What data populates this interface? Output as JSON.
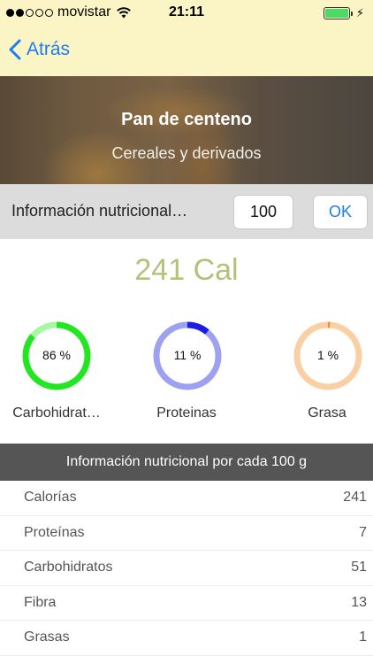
{
  "status_bar": {
    "carrier": "movistar",
    "signal_bars_filled": 2,
    "signal_bars_total": 5,
    "time": "21:11",
    "battery_level": 1.0
  },
  "nav": {
    "back_label": "Atrás"
  },
  "food": {
    "name": "Pan de centeno",
    "category": "Cereales y derivados"
  },
  "info_bar": {
    "label": "Información nutricional…",
    "quantity": "100",
    "ok_label": "OK"
  },
  "calories": "241 Cal",
  "macros": [
    {
      "label": "Carbohidrat…",
      "percent_text": "86 %",
      "percent": 86,
      "color": "#22e622",
      "track_color": "#a7f7a3"
    },
    {
      "label": "Proteinas",
      "percent_text": "11 %",
      "percent": 11,
      "color": "#1c1ce6",
      "track_color": "#9ea1f2"
    },
    {
      "label": "Grasa",
      "percent_text": "1 %",
      "percent": 1,
      "color": "#f58a1f",
      "track_color": "#f9cfa3"
    }
  ],
  "table": {
    "header": "Información nutricional por cada 100 g",
    "rows": [
      {
        "name": "Calorías",
        "value": "241"
      },
      {
        "name": "Proteínas",
        "value": "7"
      },
      {
        "name": "Carbohidratos",
        "value": "51"
      },
      {
        "name": "Fibra",
        "value": "13"
      },
      {
        "name": "Grasas",
        "value": "1"
      }
    ]
  },
  "colors": {
    "accent": "#1c7cf0",
    "topbar": "#fbf5c6",
    "calories": "#b2c27a",
    "table_header": "#555555"
  }
}
